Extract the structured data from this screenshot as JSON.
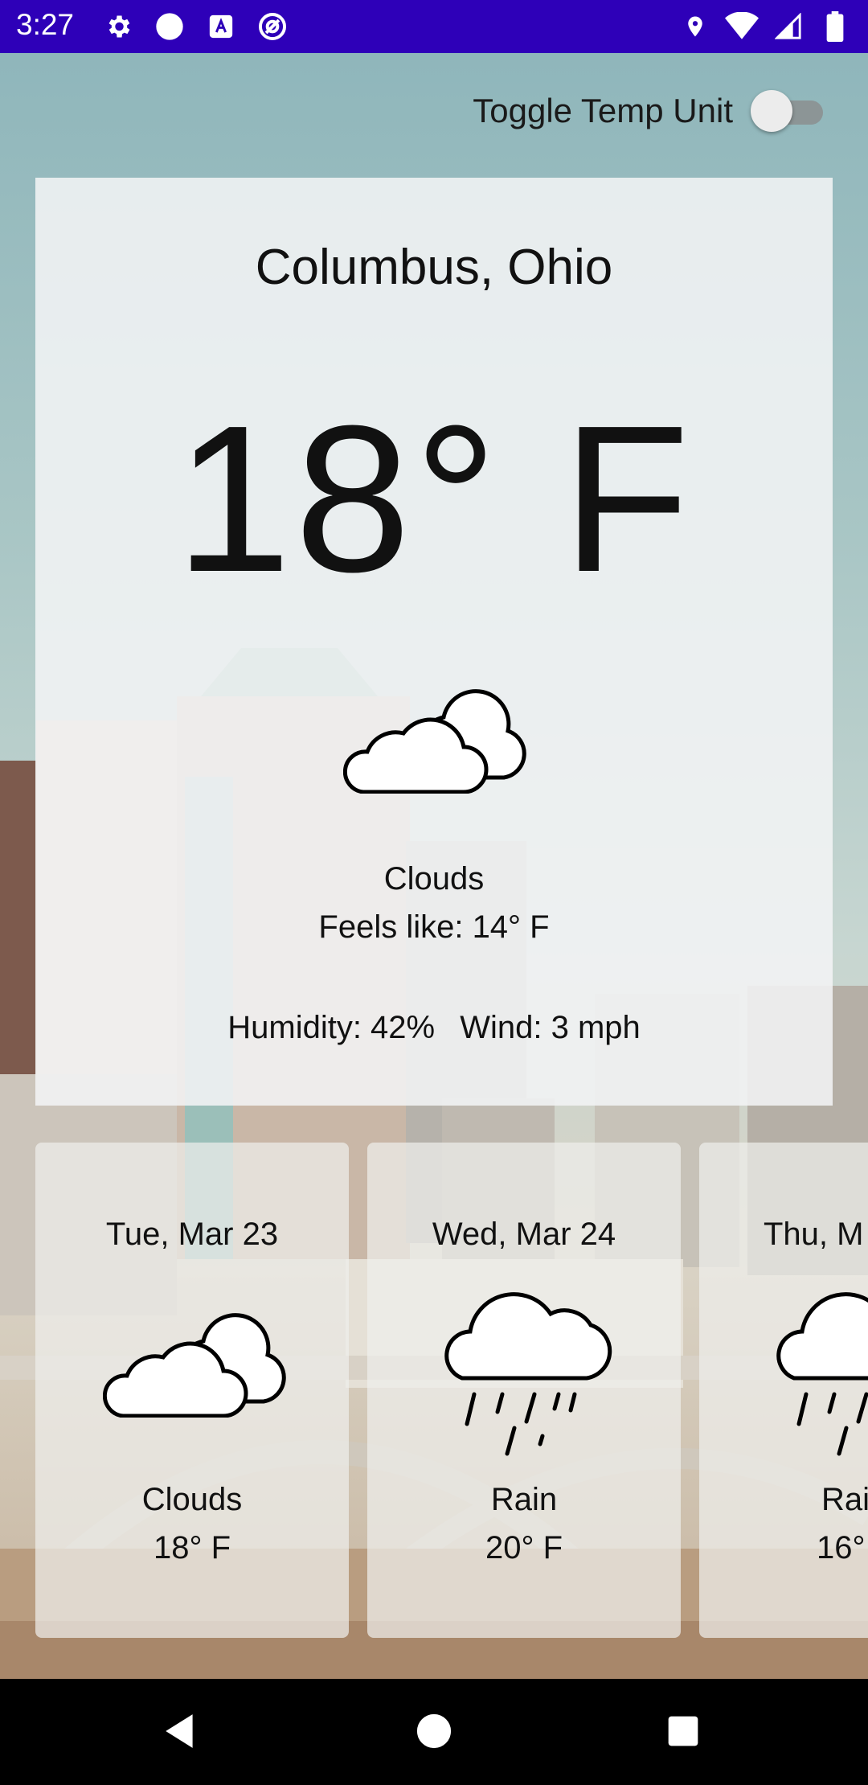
{
  "status_bar": {
    "time": "3:27",
    "left_icons": [
      "gear-icon",
      "circle-icon",
      "font-a-icon",
      "at-sign-icon"
    ],
    "right_icons": [
      "location-pin-icon",
      "wifi-icon",
      "signal-icon",
      "battery-icon"
    ],
    "background_color": "#2e00b8"
  },
  "toggle": {
    "label": "Toggle Temp Unit",
    "state": "off"
  },
  "current": {
    "city": "Columbus, Ohio",
    "temperature": "18° F",
    "icon": "clouds-icon",
    "condition": "Clouds",
    "feels_like": "Feels like: 14° F",
    "humidity": "Humidity: 42%",
    "wind": "Wind: 3 mph"
  },
  "forecast": [
    {
      "date": "Tue, Mar 23",
      "icon": "clouds-icon",
      "condition": "Clouds",
      "temp": "18° F"
    },
    {
      "date": "Wed, Mar 24",
      "icon": "rain-icon",
      "condition": "Rain",
      "temp": "20° F"
    },
    {
      "date": "Thu, M",
      "icon": "rain-icon",
      "condition": "Rai",
      "temp": "16°"
    }
  ],
  "nav": [
    "back-icon",
    "home-icon",
    "recents-icon"
  ]
}
